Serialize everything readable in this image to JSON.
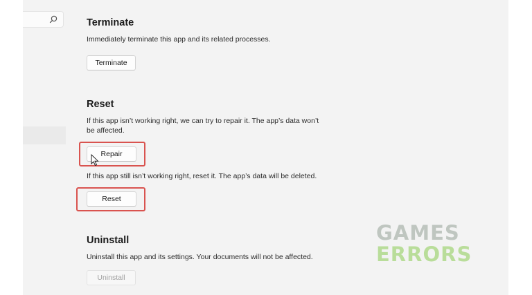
{
  "sections": {
    "terminate": {
      "title": "Terminate",
      "description": "Immediately terminate this app and its related processes.",
      "button": "Terminate"
    },
    "reset": {
      "title": "Reset",
      "repair_description": "If this app isn’t working right, we can try to repair it. The app’s data won’t be affected.",
      "repair_button": "Repair",
      "reset_description": "If this app still isn’t working right, reset it. The app’s data will be deleted.",
      "reset_button": "Reset"
    },
    "uninstall": {
      "title": "Uninstall",
      "description": "Uninstall this app and its settings. Your documents will not be affected.",
      "button": "Uninstall"
    }
  },
  "watermark": {
    "line1": "GAMES",
    "line2": "ERRORS"
  },
  "colors": {
    "highlight": "#d9534f",
    "watermark_gray": "#bfc6c0",
    "watermark_green": "#b9dd9a"
  },
  "icons": {
    "search": "search-icon",
    "cursor": "mouse-pointer-icon"
  }
}
